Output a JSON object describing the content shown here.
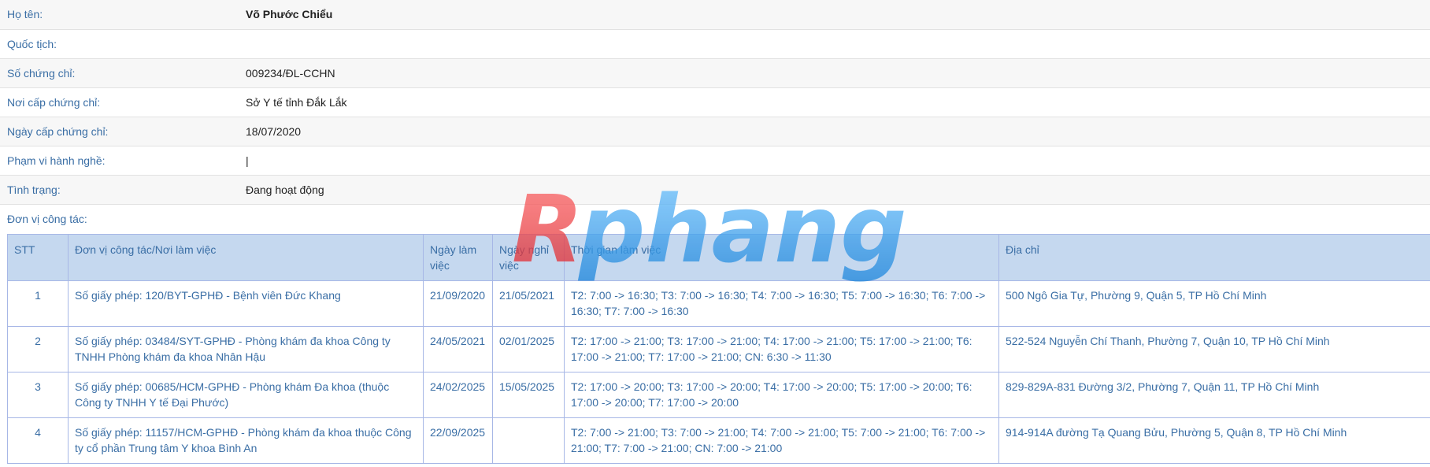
{
  "profile": {
    "fields": [
      {
        "label": "Họ tên:",
        "value": "Võ Phước Chiểu",
        "bold": true
      },
      {
        "label": "Quốc tịch:",
        "value": ""
      },
      {
        "label": "Số chứng chỉ:",
        "value": "009234/ĐL-CCHN"
      },
      {
        "label": "Nơi cấp chứng chỉ:",
        "value": "Sở Y tế tỉnh Đắk Lắk"
      },
      {
        "label": "Ngày cấp chứng chỉ:",
        "value": "18/07/2020"
      },
      {
        "label": "Phạm vi hành nghề:",
        "value": "|"
      },
      {
        "label": "Tình trạng:",
        "value": "Đang hoạt động"
      }
    ]
  },
  "workplace": {
    "title": "Đơn vị công tác:",
    "headers": {
      "stt": "STT",
      "unit": "Đơn vị công tác/Nơi làm việc",
      "start": "Ngày làm việc",
      "end": "Ngày nghỉ việc",
      "hours": "Thời gian làm việc",
      "address": "Địa chỉ"
    },
    "rows": [
      {
        "stt": "1",
        "unit": "Số giấy phép: 120/BYT-GPHĐ - Bệnh viên Đức Khang",
        "start": "21/09/2020",
        "end": "21/05/2021",
        "hours": "T2: 7:00 -> 16:30; T3: 7:00 -> 16:30; T4: 7:00 -> 16:30; T5: 7:00 -> 16:30; T6: 7:00 -> 16:30; T7: 7:00 -> 16:30",
        "address": "500 Ngô Gia Tự, Phường 9, Quận 5, TP Hồ Chí Minh"
      },
      {
        "stt": "2",
        "unit": "Số giấy phép: 03484/SYT-GPHĐ - Phòng khám đa khoa Công ty TNHH Phòng khám đa khoa Nhân Hậu",
        "start": "24/05/2021",
        "end": "02/01/2025",
        "hours": "T2: 17:00 -> 21:00; T3: 17:00 -> 21:00; T4: 17:00 -> 21:00; T5: 17:00 -> 21:00; T6: 17:00 -> 21:00; T7: 17:00 -> 21:00; CN: 6:30 -> 11:30",
        "address": "522-524 Nguyễn Chí Thanh, Phường 7, Quận 10, TP Hồ Chí Minh"
      },
      {
        "stt": "3",
        "unit": "Số giấy phép: 00685/HCM-GPHĐ - Phòng khám Đa khoa (thuộc Công ty TNHH Y tế Đại Phước)",
        "start": "24/02/2025",
        "end": "15/05/2025",
        "hours": "T2: 17:00 -> 20:00; T3: 17:00 -> 20:00; T4: 17:00 -> 20:00; T5: 17:00 -> 20:00; T6: 17:00 -> 20:00; T7: 17:00 -> 20:00",
        "address": "829-829A-831 Đường 3/2, Phường 7, Quận 11, TP Hồ Chí Minh"
      },
      {
        "stt": "4",
        "unit": "Số giấy phép: 11157/HCM-GPHĐ - Phòng khám đa khoa thuộc Công ty cổ phần Trung tâm Y khoa Bình An",
        "start": "22/09/2025",
        "end": "",
        "hours": "T2: 7:00 -> 21:00; T3: 7:00 -> 21:00; T4: 7:00 -> 21:00; T5: 7:00 -> 21:00; T6: 7:00 -> 21:00; T7: 7:00 -> 21:00; CN: 7:00 -> 21:00",
        "address": "914-914A đường Tạ Quang Bửu, Phường 5, Quận 8, TP Hồ Chí Minh"
      }
    ]
  },
  "watermark": {
    "text": "Rphang",
    "colors": {
      "left": "#e8333b",
      "right": "#2f9be8"
    }
  }
}
